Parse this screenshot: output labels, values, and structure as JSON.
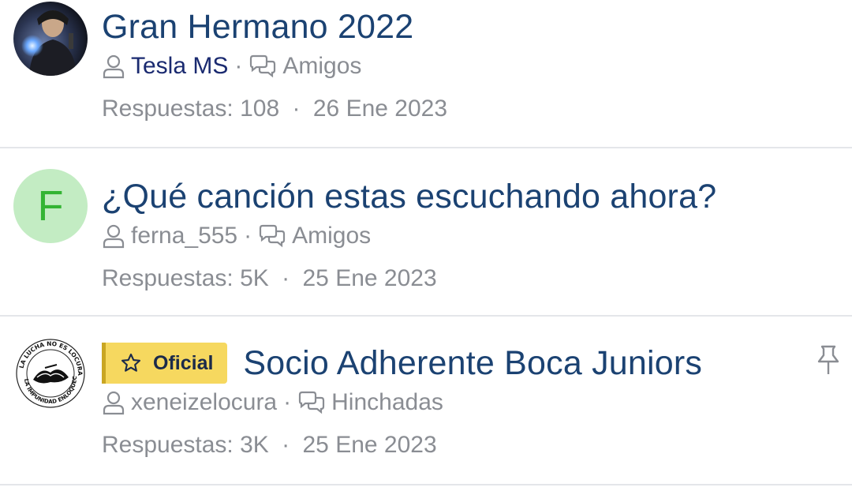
{
  "threads": [
    {
      "avatar": {
        "type": "image",
        "icon": "hooded-figure-avatar-icon"
      },
      "badge": null,
      "title": "Gran Hermano 2022",
      "author": "Tesla MS",
      "forum": "Amigos",
      "replies_label": "Respuestas:",
      "replies": "108",
      "separator": "·",
      "date": "26 Ene 2023",
      "pinned": false
    },
    {
      "avatar": {
        "type": "letter",
        "letter": "F",
        "bg": "#c3ecc3",
        "fg": "#34b434"
      },
      "badge": null,
      "title": "¿Qué canción estas escuchando ahora?",
      "author": "ferna_555",
      "forum": "Amigos",
      "replies_label": "Respuestas:",
      "replies": "5K",
      "separator": "·",
      "date": "25 Ene 2023",
      "pinned": false
    },
    {
      "avatar": {
        "type": "image",
        "icon": "la-lucha-logo-icon",
        "logo_text": "LA LUCHA NO ES LOCURA · LA IMPUNIDAD ENLOQUECE"
      },
      "badge": {
        "label": "Oficial",
        "icon": "star-icon"
      },
      "title": "Socio Adherente Boca Juniors",
      "author": "xeneizelocura",
      "forum": "Hinchadas",
      "replies_label": "Respuestas:",
      "replies": "3K",
      "separator": "·",
      "date": "25 Ene 2023",
      "pinned": true
    }
  ],
  "colors": {
    "title": "#1b4272",
    "meta": "#8a8d93",
    "highlighted_author": "#1a2a70",
    "badge_bg": "#f6d85f",
    "divider": "#e4e6ea"
  }
}
